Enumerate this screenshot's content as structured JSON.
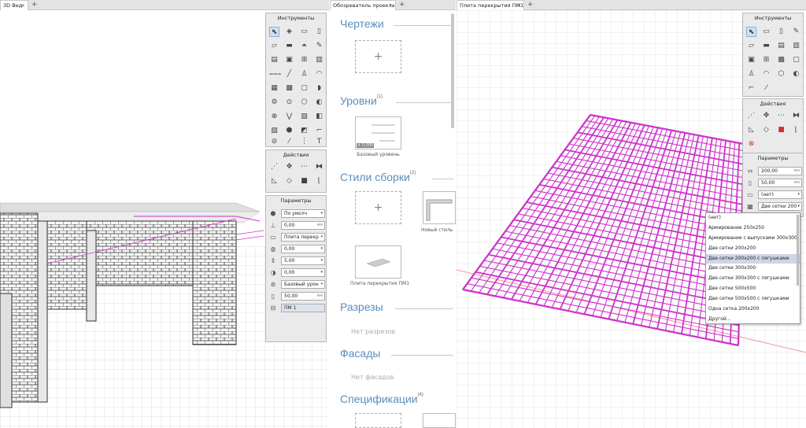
{
  "tabs": {
    "view3d": "3D Вид",
    "browser": "Обозреватель проекта",
    "slab": "Плита перекрытия ПМ1"
  },
  "left": {
    "tools_title": "Инструменты",
    "actions_title": "Действия",
    "params_title": "Параметры",
    "params": {
      "preset": "По умолч",
      "v1": "0,00",
      "v1_unit": "мм",
      "element": "Плита перекр",
      "v2": "0,00",
      "v3": "5,00",
      "v4": "0,00",
      "level": "Базовый урон",
      "v5": "50,00",
      "v5_unit": "мм",
      "name": "ПМ 1"
    }
  },
  "browser": {
    "drawings": "Чертежи",
    "levels": "Уровни",
    "levels_count": "(1)",
    "level_tag": "± 0,000",
    "level_name": "Базовый уровень",
    "styles": "Стили сборки",
    "styles_count": "(2)",
    "new_style": "Новый стиль",
    "slab_style": "Плита перекрытия ПМ1",
    "sections": "Разрезы",
    "no_sections": "Нет разрезов",
    "facades": "Фасады",
    "no_facades": "Нет фасадов",
    "specs": "Спецификации",
    "specs_count": "(4)"
  },
  "right": {
    "tools_title": "Инструменты",
    "actions_title": "Действия",
    "params_title": "Параметры",
    "params": {
      "width": "200,00",
      "width_unit": "мм",
      "thick": "50,00",
      "thick_unit": "мм",
      "mat": "(нет)",
      "rebar": "Две сетки 200"
    }
  },
  "dropdown": {
    "items": [
      "(нет)",
      "Армирование 250х250",
      "Армирование с выпусками 300х300",
      "Две сетки 200х200",
      "Две сетки 200х200 с лягушками",
      "Две сетки 300х300",
      "Две сетки 300х300 с лягушками",
      "Две сетки 500х500",
      "Две сетки 500х500 с лягушками",
      "Одна сетка 200х200",
      "Другой..."
    ],
    "selected_index": 4
  },
  "colors": {
    "accent": "#5b8dbb",
    "rebar": "#cc33cc"
  }
}
